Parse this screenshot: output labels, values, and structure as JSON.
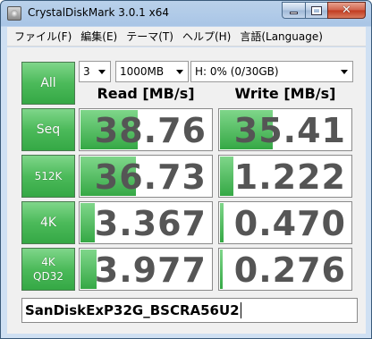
{
  "window": {
    "title": "CrystalDiskMark 3.0.1 x64"
  },
  "menu": {
    "items": [
      "ファイル(F)",
      "編集(E)",
      "テーマ(T)",
      "ヘルプ(H)",
      "言語(Language)"
    ]
  },
  "controls": {
    "all_label": "All",
    "runs_value": "3",
    "size_value": "1000MB",
    "drive_value": "H: 0% (0/30GB)"
  },
  "headers": {
    "read": "Read [MB/s]",
    "write": "Write [MB/s]"
  },
  "rows": [
    {
      "label": "Seq",
      "label2": "",
      "read": "38.76",
      "write": "35.41",
      "read_fill": 0.43,
      "write_fill": 0.4
    },
    {
      "label": "512K",
      "label2": "",
      "read": "36.73",
      "write": "1.222",
      "read_fill": 0.42,
      "write_fill": 0.1
    },
    {
      "label": "4K",
      "label2": "",
      "read": "3.367",
      "write": "0.470",
      "read_fill": 0.11,
      "write_fill": 0.03
    },
    {
      "label": "4K",
      "label2": "QD32",
      "read": "3.977",
      "write": "0.276",
      "read_fill": 0.12,
      "write_fill": 0.02
    }
  ],
  "comment": {
    "value": "SanDiskExP32G_BSCRA56U2"
  },
  "colors": {
    "accent_green": "#35a845",
    "title_bar": "#b9d1ea",
    "value_text": "#555555"
  }
}
